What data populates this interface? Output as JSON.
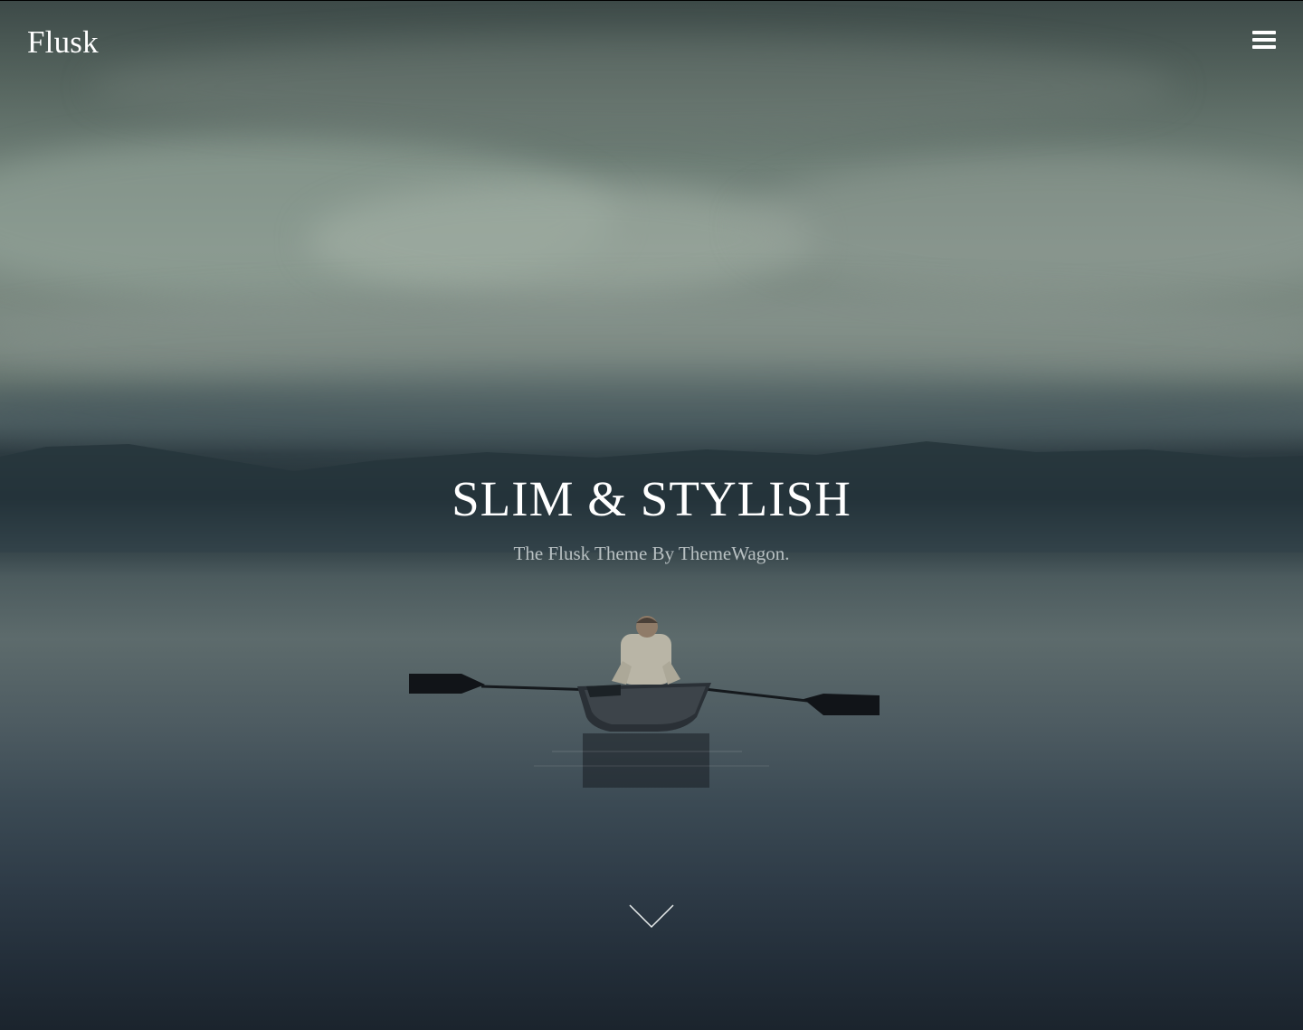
{
  "brand": {
    "name": "Flusk"
  },
  "nav": {
    "menu_icon": "hamburger-menu-icon"
  },
  "hero": {
    "title": "SLIM & STYLISH",
    "subtitle": "The Flusk Theme By ThemeWagon.",
    "scroll_icon": "chevron-down-icon"
  },
  "colors": {
    "text_primary": "#ffffff",
    "text_secondary": "#b8c0c2",
    "sky": "#7e8d85",
    "water": "#2e3b47"
  }
}
